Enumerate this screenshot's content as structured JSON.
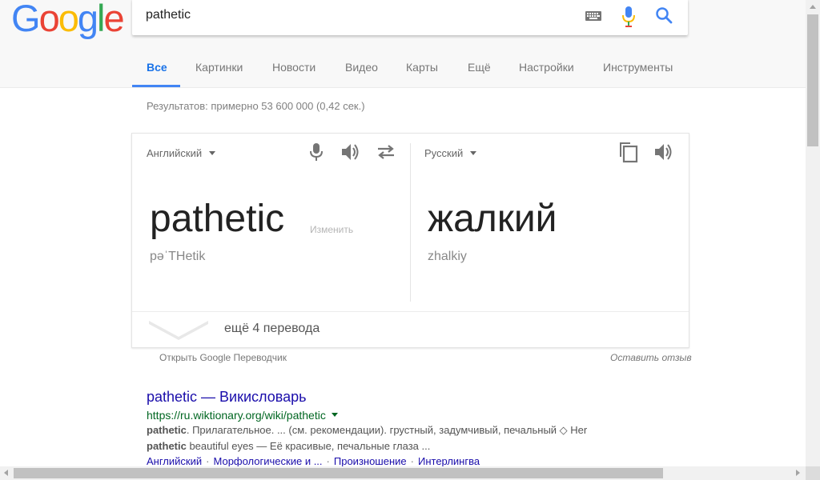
{
  "logo": {
    "letters": [
      "G",
      "o",
      "o",
      "g",
      "l",
      "e"
    ],
    "colors": [
      "#4285f4",
      "#ea4335",
      "#fbbc05",
      "#4285f4",
      "#34a853",
      "#ea4335"
    ]
  },
  "search": {
    "query": "pathetic"
  },
  "tabs": [
    "Все",
    "Картинки",
    "Новости",
    "Видео",
    "Карты",
    "Ещё",
    "Настройки",
    "Инструменты"
  ],
  "stats": "Результатов: примерно 53 600 000 (0,42 сек.)",
  "translate": {
    "source_lang": "Английский",
    "target_lang": "Русский",
    "source_word": "pathetic",
    "change_label": "Изменить",
    "source_translit": "pəˈTHetik",
    "target_word": "жалкий",
    "target_translit": "zhalkiy",
    "more": "ещё 4 перевода",
    "open_link": "Открыть Google Переводчик",
    "feedback": "Оставить отзыв"
  },
  "result": {
    "title": "pathetic — Викисловарь",
    "url": "https://ru.wiktionary.org/wiki/pathetic",
    "snippet1_bold": "pathetic",
    "snippet1_rest": ". Прилагательное. ... (см. рекомендации). грустный, задумчивый, печальный ◇ Her",
    "snippet2_bold": "pathetic",
    "snippet2_rest": " beautiful eyes — Её красивые, печальные глаза ...",
    "sitelinks": [
      "Английский",
      "Морфологические и ...",
      "Произношение",
      "Интерлингва"
    ]
  },
  "icons": {
    "keyboard": "keyboard-icon",
    "mic": "microphone-icon",
    "search": "search-icon",
    "speaker": "speaker-icon",
    "swap": "swap-icon",
    "copy": "copy-icon",
    "chevron": "chevron-down-icon"
  }
}
